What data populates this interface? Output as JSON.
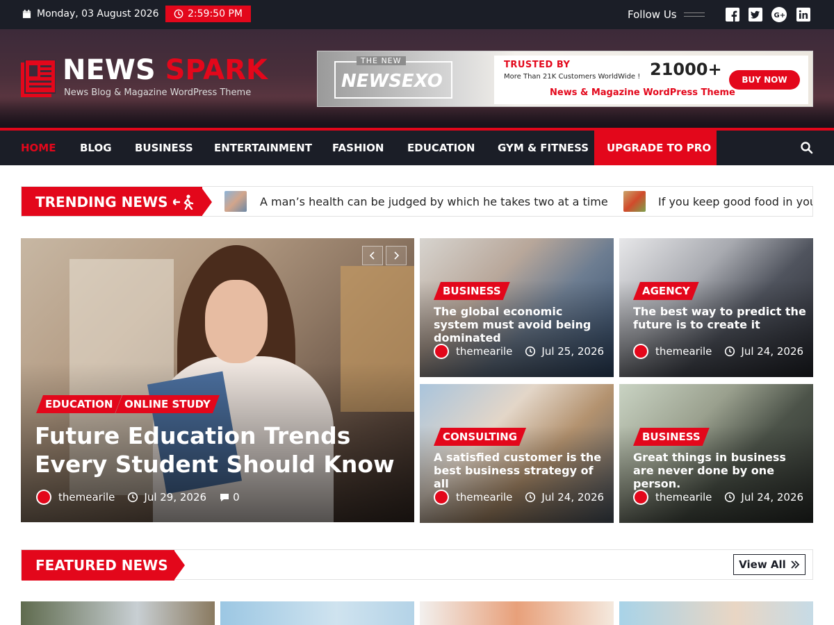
{
  "topbar": {
    "date": "Monday, 03 August 2026",
    "time": "2:59:50 PM",
    "follow_label": "Follow Us",
    "social": [
      "facebook-icon",
      "twitter-icon",
      "google-plus-icon",
      "linkedin-icon"
    ]
  },
  "header": {
    "logo_word1": "NEWS",
    "logo_word2": "SPARK",
    "tagline": "News Blog & Magazine WordPress Theme",
    "banner": {
      "the_new": "THE NEW",
      "product": "NEWSEXO",
      "trusted": "TRUSTED BY",
      "customers": "More Than 21K Customers WorldWide !",
      "count": "21000+",
      "subtitle": "News & Magazine WordPress Theme",
      "cta": "BUY NOW"
    }
  },
  "nav": {
    "items": [
      "HOME",
      "BLOG",
      "BUSINESS",
      "ENTERTAINMENT",
      "FASHION",
      "EDUCATION",
      "GYM & FITNESS"
    ],
    "pro": "UPGRADE TO PRO",
    "active": "HOME"
  },
  "trending": {
    "label": "TRENDING NEWS",
    "items": [
      "A man’s health can be judged by which he takes two at a time",
      "If you keep good food in you"
    ]
  },
  "hero": {
    "categories": [
      "EDUCATION",
      "ONLINE STUDY"
    ],
    "title": "Future Education Trends Every Student Should Know",
    "author": "themearile",
    "date": "Jul 29, 2026",
    "comments": "0"
  },
  "cards": [
    {
      "category": "BUSINESS",
      "title": "The global economic system must avoid being dominated",
      "author": "themearile",
      "date": "Jul 25, 2026"
    },
    {
      "category": "AGENCY",
      "title": "The best way to predict the future is to create it",
      "author": "themearile",
      "date": "Jul 24, 2026"
    },
    {
      "category": "CONSULTING",
      "title": "A satisfied customer is the best business strategy of all",
      "author": "themearile",
      "date": "Jul 24, 2026"
    },
    {
      "category": "BUSINESS",
      "title": "Great things in business are never done by one person.",
      "author": "themearile",
      "date": "Jul 24, 2026"
    }
  ],
  "featured": {
    "label": "FEATURED NEWS",
    "view_all": "View All"
  },
  "colors": {
    "accent": "#e3071b",
    "dark": "#1b1e27"
  }
}
